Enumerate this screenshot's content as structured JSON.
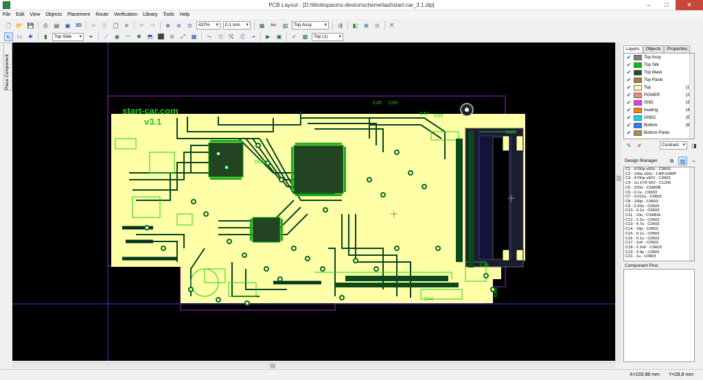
{
  "window": {
    "title": "PCB Layout - [D:\\Workspace\\s-device\\scheme\\last\\start-car_3.1.dip]",
    "minimize": "–",
    "maximize": "□",
    "close": "✕"
  },
  "menu": [
    "File",
    "Edit",
    "View",
    "Objects",
    "Placement",
    "Route",
    "Verification",
    "Library",
    "Tools",
    "Help"
  ],
  "toolbar1": {
    "zoom": "437%",
    "grid": "0,1 mm",
    "layer": "Top Assy",
    "three_d": "3D",
    "abc": "Abc"
  },
  "toolbar2": {
    "side": "Top Side",
    "top_layer": "Top (1)"
  },
  "sidetab": {
    "label": "Place Component"
  },
  "right_panel": {
    "tabs": [
      "Layers",
      "Objects",
      "Properties"
    ],
    "layers": [
      {
        "name": "Top Assy",
        "color": "#808080",
        "num": ""
      },
      {
        "name": "Top Silk",
        "color": "#00c000",
        "num": ""
      },
      {
        "name": "Top Mask",
        "color": "#205020",
        "num": ""
      },
      {
        "name": "Top Paste",
        "color": "#9a8a30",
        "num": ""
      },
      {
        "name": "Top",
        "color": "#ffffa8",
        "num": "(1)"
      },
      {
        "name": "POWER",
        "color": "#ff8080",
        "num": "(2)"
      },
      {
        "name": "GND",
        "color": "#e040e0",
        "num": "(3)"
      },
      {
        "name": "heating",
        "color": "#ff8000",
        "num": "(4)"
      },
      {
        "name": "GND2",
        "color": "#00e0e0",
        "num": "(5)"
      },
      {
        "name": "Bottom",
        "color": "#2080ff",
        "num": "(6)"
      },
      {
        "name": "Bottom Paste",
        "color": "#b09040",
        "num": ""
      }
    ],
    "contrast": "Contrast",
    "design_manager": "Design Manager",
    "components": [
      "C1 - 4700p x50V - C0603",
      "C2 - 100u x50v - CAP100RP",
      "C3 - 4700p x50V - C0603",
      "C4 - 1u X7R 50V - C1206",
      "C5 - 220u - CSMDB",
      "C6 - 0.1u - C0603",
      "C7 - 0.012u - C0603",
      "C8 - 100p - C0603",
      "C9 - 0.33u - C0603",
      "C10 - 0.1u - C0603",
      "C11 - 10u - CSMDA",
      "C12 - 2.2u - C0603",
      "C13 - 4.7u - C0603",
      "C14 - 18p - C0603",
      "C15 - 0.1u - C0603",
      "C16 - 0.1u - C0603",
      "C17 - 1nF - C0603",
      "C18 - 2.2nF - C0603",
      "C19 - 3.9p - C0603",
      "C21 - 1u - C0603"
    ],
    "pins_label": "Component Pins:"
  },
  "pcb": {
    "brand": "start-car.com",
    "version": "v3.1",
    "labels": [
      "C42",
      "C43",
      "XW2",
      "DD2",
      "XW1",
      "C18",
      "C44",
      "C30",
      "C26"
    ]
  },
  "status": {
    "x": "X=103,98 mm",
    "y": "Y=28,8 mm"
  }
}
